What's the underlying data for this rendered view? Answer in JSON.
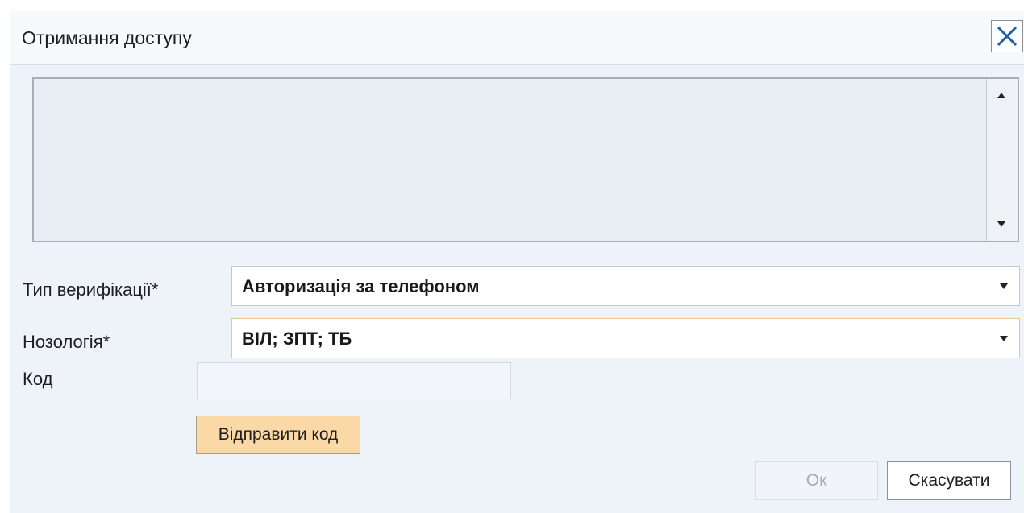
{
  "dialog": {
    "title": "Отримання доступу",
    "close_icon": "close-icon"
  },
  "message_area": {
    "text": "",
    "scroll_up_icon": "triangle-up-icon",
    "scroll_down_icon": "triangle-down-icon"
  },
  "form": {
    "verification_type": {
      "label": "Тип верифікації*",
      "value": "Авторизація за телефоном"
    },
    "nosology": {
      "label": "Нозологія*",
      "value": "ВІЛ; ЗПТ; ТБ"
    },
    "code": {
      "label": "Код",
      "value": ""
    },
    "send_code_label": "Відправити код"
  },
  "footer": {
    "ok_label": "Ок",
    "cancel_label": "Скасувати"
  },
  "colors": {
    "dialog_bg": "#eef3fa",
    "accent_button": "#fbd9a6",
    "focus_border": "#e8c58a",
    "close_icon": "#1f5fa8"
  }
}
